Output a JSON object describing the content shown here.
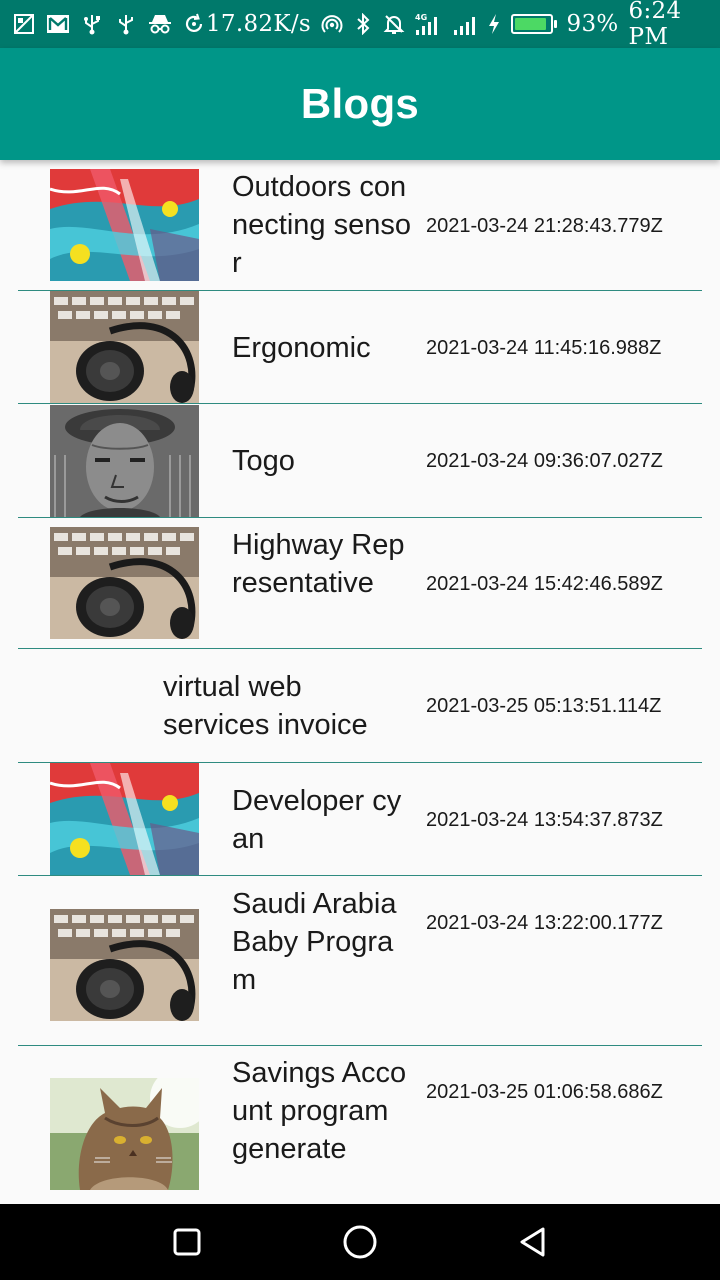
{
  "status_bar": {
    "network_speed": "17.82K/s",
    "battery_percent": "93%",
    "battery_level": 0.93,
    "time": "6:24 PM",
    "network_type": "4G",
    "left_icons": [
      "screenshot-icon",
      "gmail-icon",
      "usb-icon",
      "usb-debug-icon",
      "incognito-icon",
      "sync-icon"
    ],
    "right_icons": [
      "hotspot-icon",
      "bluetooth-icon",
      "mute-icon",
      "signal-4g-icon",
      "signal-icon",
      "charging-icon",
      "battery-icon"
    ]
  },
  "app_bar": {
    "title": "Blogs"
  },
  "blogs": [
    {
      "title": "Outdoors connecting sensor",
      "date": "2021-03-24 21:28:43.779Z",
      "image": "abstract-paint"
    },
    {
      "title": "Ergonomic",
      "date": "2021-03-24 11:45:16.988Z",
      "image": "headphones"
    },
    {
      "title": "Togo",
      "date": "2021-03-24 09:36:07.027Z",
      "image": "portrait-bw"
    },
    {
      "title": "Highway Representative",
      "date": "2021-03-24 15:42:46.589Z",
      "image": "headphones"
    },
    {
      "title": "virtual web services invoice",
      "date": "2021-03-25 05:13:51.114Z",
      "image": "none"
    },
    {
      "title": "Developer cyan",
      "date": "2021-03-24 13:54:37.873Z",
      "image": "abstract-paint"
    },
    {
      "title": "Saudi Arabia Baby Program",
      "date": "2021-03-24 13:22:00.177Z",
      "image": "headphones"
    },
    {
      "title": "Savings Account program generate",
      "date": "2021-03-25 01:06:58.686Z",
      "image": "cat"
    }
  ],
  "nav_bar": {
    "icons": [
      "recent-apps-icon",
      "home-icon",
      "back-icon"
    ]
  },
  "colors": {
    "status_bar": "#00796b",
    "app_bar": "#009688",
    "divider": "#2e8b80",
    "background": "#fafafa",
    "battery_fill": "#4cd964"
  }
}
